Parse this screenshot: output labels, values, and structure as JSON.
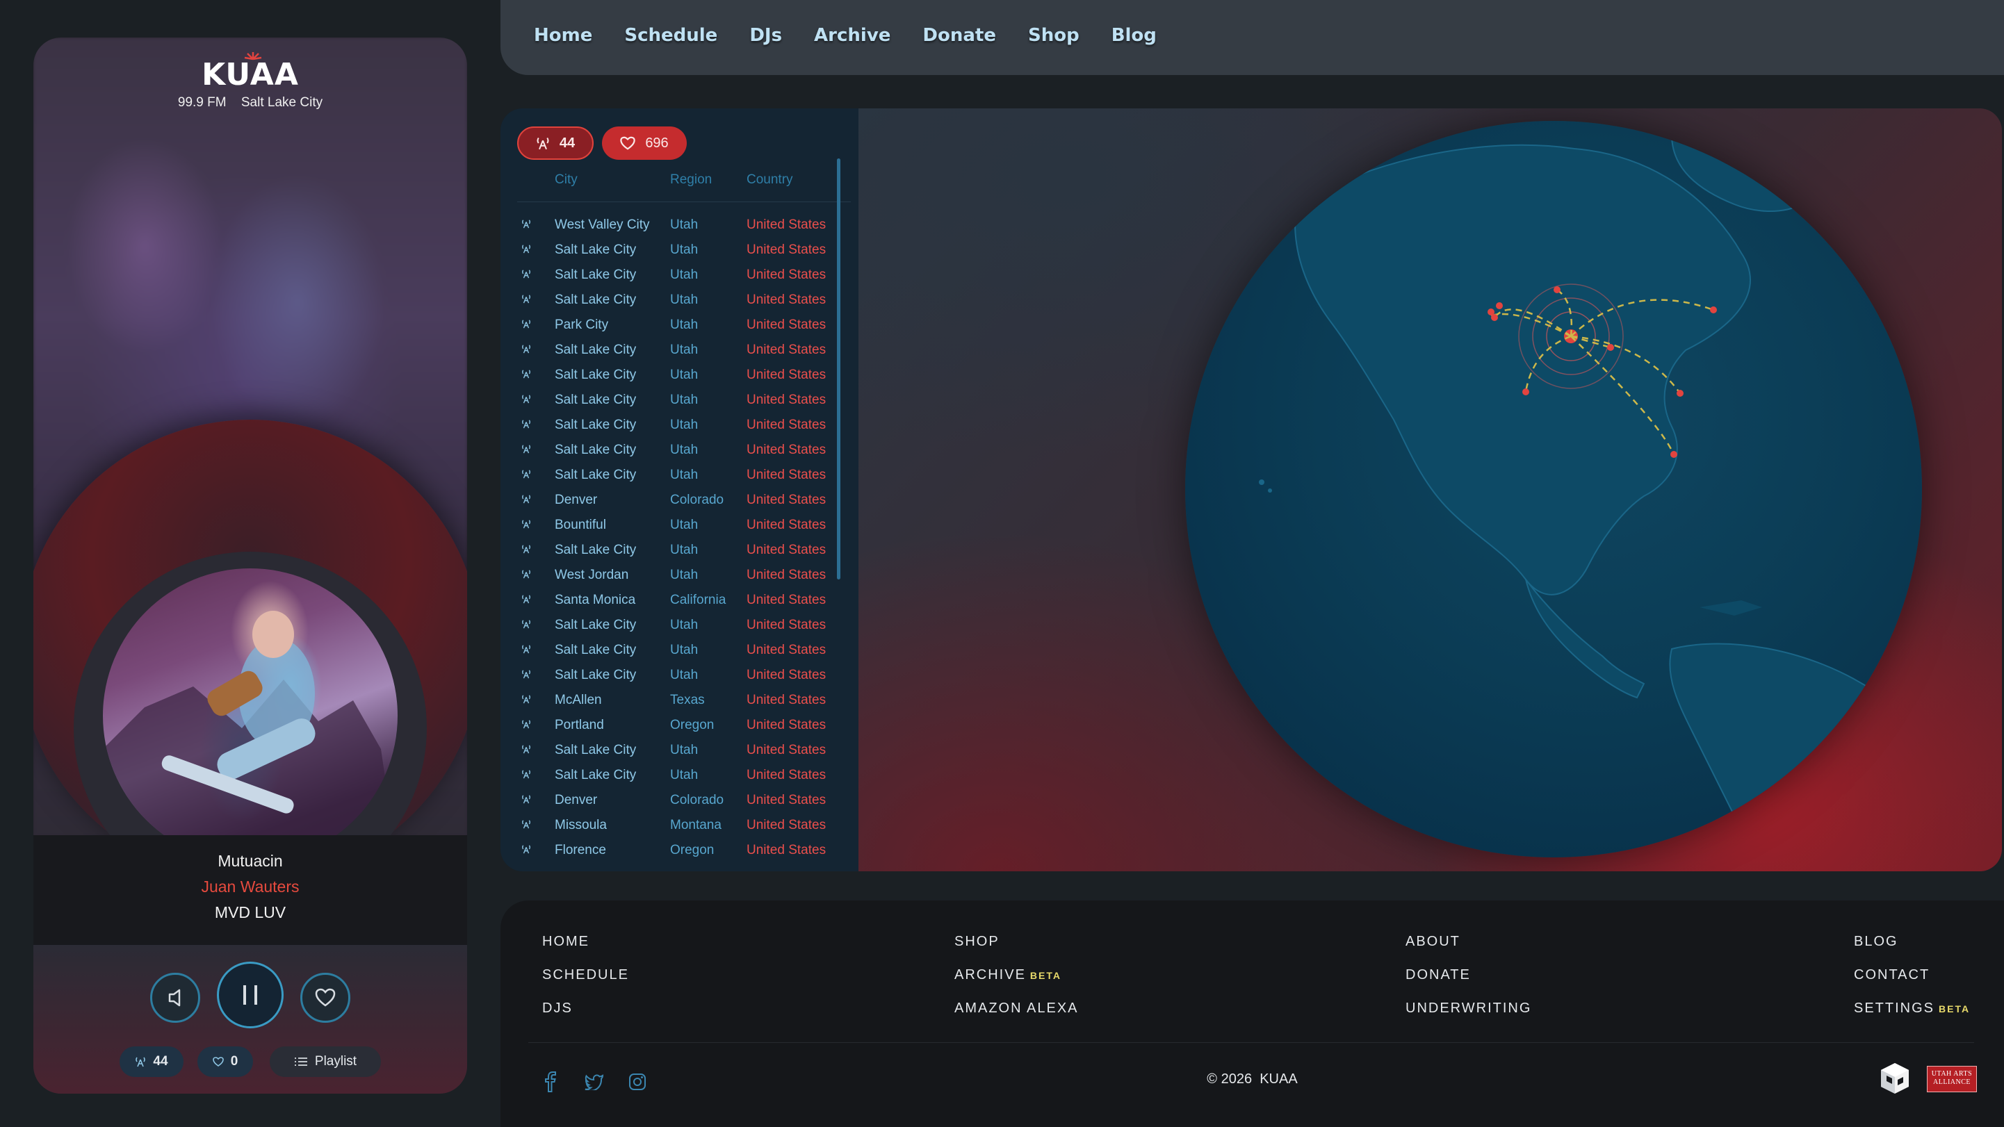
{
  "station": {
    "name": "KUAA",
    "frequency": "99.9 FM",
    "city": "Salt Lake City"
  },
  "now_playing": {
    "title": "Mutuacin",
    "artist": "Juan Wauters",
    "album": "MVD LUV",
    "listeners": "44",
    "likes": "0",
    "playlist_label": "Playlist"
  },
  "nav": {
    "items": [
      "Home",
      "Schedule",
      "DJs",
      "Archive",
      "Donate",
      "Shop",
      "Blog"
    ]
  },
  "listeners_panel": {
    "listener_count": "44",
    "like_count": "696",
    "headers": {
      "city": "City",
      "region": "Region",
      "country": "Country"
    },
    "rows": [
      {
        "city": "West Valley City",
        "region": "Utah",
        "country": "United States"
      },
      {
        "city": "Salt Lake City",
        "region": "Utah",
        "country": "United States"
      },
      {
        "city": "Salt Lake City",
        "region": "Utah",
        "country": "United States"
      },
      {
        "city": "Salt Lake City",
        "region": "Utah",
        "country": "United States"
      },
      {
        "city": "Park City",
        "region": "Utah",
        "country": "United States"
      },
      {
        "city": "Salt Lake City",
        "region": "Utah",
        "country": "United States"
      },
      {
        "city": "Salt Lake City",
        "region": "Utah",
        "country": "United States"
      },
      {
        "city": "Salt Lake City",
        "region": "Utah",
        "country": "United States"
      },
      {
        "city": "Salt Lake City",
        "region": "Utah",
        "country": "United States"
      },
      {
        "city": "Salt Lake City",
        "region": "Utah",
        "country": "United States"
      },
      {
        "city": "Salt Lake City",
        "region": "Utah",
        "country": "United States"
      },
      {
        "city": "Denver",
        "region": "Colorado",
        "country": "United States"
      },
      {
        "city": "Bountiful",
        "region": "Utah",
        "country": "United States"
      },
      {
        "city": "Salt Lake City",
        "region": "Utah",
        "country": "United States"
      },
      {
        "city": "West Jordan",
        "region": "Utah",
        "country": "United States"
      },
      {
        "city": "Santa Monica",
        "region": "California",
        "country": "United States"
      },
      {
        "city": "Salt Lake City",
        "region": "Utah",
        "country": "United States"
      },
      {
        "city": "Salt Lake City",
        "region": "Utah",
        "country": "United States"
      },
      {
        "city": "Salt Lake City",
        "region": "Utah",
        "country": "United States"
      },
      {
        "city": "McAllen",
        "region": "Texas",
        "country": "United States"
      },
      {
        "city": "Portland",
        "region": "Oregon",
        "country": "United States"
      },
      {
        "city": "Salt Lake City",
        "region": "Utah",
        "country": "United States"
      },
      {
        "city": "Salt Lake City",
        "region": "Utah",
        "country": "United States"
      },
      {
        "city": "Denver",
        "region": "Colorado",
        "country": "United States"
      },
      {
        "city": "Missoula",
        "region": "Montana",
        "country": "United States"
      },
      {
        "city": "Florence",
        "region": "Oregon",
        "country": "United States"
      }
    ]
  },
  "footer": {
    "col1": [
      "HOME",
      "SCHEDULE",
      "DJS"
    ],
    "col2": [
      {
        "label": "SHOP",
        "badge": ""
      },
      {
        "label": "ARCHIVE",
        "badge": "BETA"
      },
      {
        "label": "AMAZON ALEXA",
        "badge": ""
      }
    ],
    "col3": [
      "ABOUT",
      "DONATE",
      "UNDERWRITING"
    ],
    "col4": [
      {
        "label": "BLOG",
        "badge": ""
      },
      {
        "label": "CONTACT",
        "badge": ""
      },
      {
        "label": "SETTINGS",
        "badge": "BETA"
      }
    ],
    "copyright_year": "© 2026",
    "copyright_name": "KUAA",
    "partner_badge": "UTAH ARTS ALLIANCE"
  },
  "colors": {
    "accent_red": "#e64a3e",
    "accent_blue": "#2d7da0",
    "nav_text": "#bfe1f3",
    "beta_badge": "#e7d96a"
  },
  "icons": {
    "listener": "radio-tower-icon",
    "like": "heart-icon",
    "volume": "speaker-icon",
    "pause": "pause-icon",
    "playlist": "list-icon",
    "socials": [
      "facebook-icon",
      "twitter-icon",
      "instagram-icon"
    ]
  }
}
